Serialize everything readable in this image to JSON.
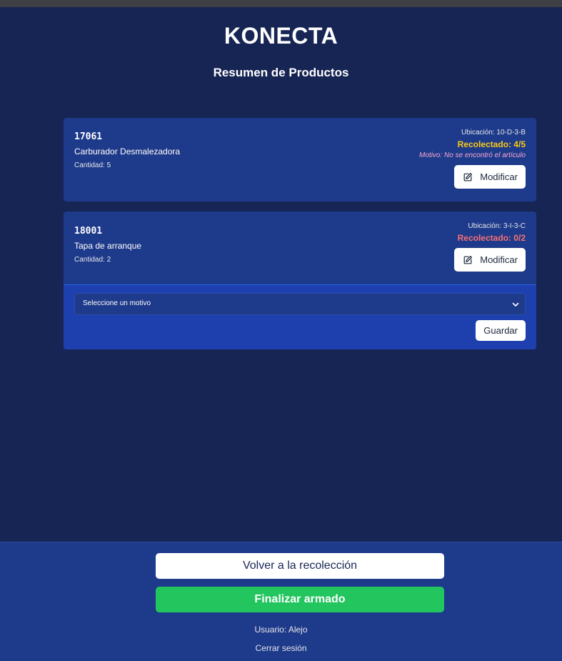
{
  "header": {
    "brand": "KONECTA",
    "subtitle": "Resumen de Productos"
  },
  "products": [
    {
      "code": "17061",
      "name": "Carburador Desmalezadora",
      "quantity": "Cantidad: 5",
      "location": "Ubicación: 10-D-3-B",
      "collected": "Recolectado: 4/5",
      "motive": "Motivo: No se encontró el artículo",
      "modify_label": "Modificar"
    },
    {
      "code": "18001",
      "name": "Tapa de arranque",
      "quantity": "Cantidad: 2",
      "location": "Ubicación: 3-I-3-C",
      "collected": "Recolectado: 0/2",
      "modify_label": "Modificar",
      "motive_select": "Seleccione un motivo",
      "save_label": "Guardar"
    }
  ],
  "footer": {
    "back_label": "Volver a la recolección",
    "finish_label": "Finalizar armado",
    "user": "Usuario: Alejo",
    "logout": "Cerrar sesión"
  },
  "colors": {
    "background": "#172554",
    "card": "#1e3a8a",
    "collected_partial": "#facc15",
    "collected_none": "#f87171",
    "finish": "#22c55e"
  }
}
